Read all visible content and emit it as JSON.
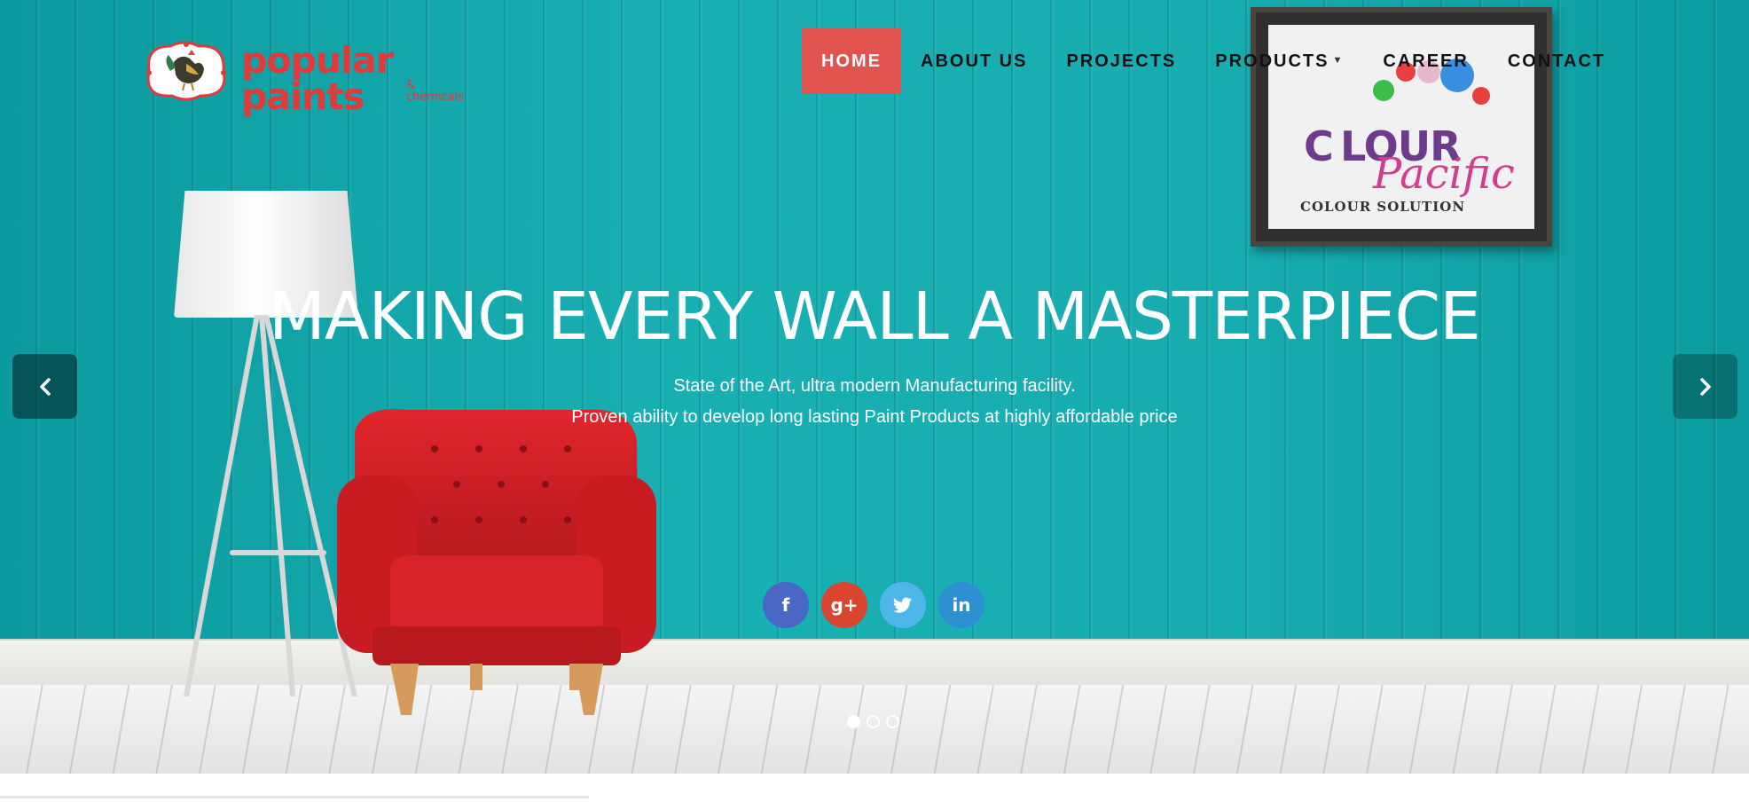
{
  "brand": {
    "name": "popular paints",
    "tagline": "& chemicals",
    "accent": "#e0534f"
  },
  "nav": {
    "items": [
      {
        "label": "HOME",
        "active": true
      },
      {
        "label": "ABOUT US",
        "active": false
      },
      {
        "label": "PROJECTS",
        "active": false
      },
      {
        "label": "PRODUCTS",
        "active": false,
        "dropdown": true
      },
      {
        "label": "CAREER",
        "active": false
      },
      {
        "label": "CONTACT",
        "active": false
      }
    ]
  },
  "hero": {
    "headline": "MAKING EVERY WALL A MASTERPIECE",
    "line1": "State of the Art, ultra modern Manufacturing facility.",
    "line2": "Proven ability to develop long lasting Paint Products at highly affordable price",
    "frame": {
      "brand_word1": "C LOUR",
      "brand_word2": "Pacific",
      "brand_line": "COLOUR SOLUTION"
    },
    "prev_icon": "chevron-left-icon",
    "next_icon": "chevron-right-icon"
  },
  "social": [
    {
      "name": "facebook",
      "glyph": "f",
      "color": "#4a67c6"
    },
    {
      "name": "google-plus",
      "glyph": "g+",
      "color": "#d9452f"
    },
    {
      "name": "twitter",
      "glyph": "t",
      "color": "#4fb6ec"
    },
    {
      "name": "linkedin",
      "glyph": "in",
      "color": "#2c8fcf"
    }
  ],
  "carousel": {
    "slides": 3,
    "active_index": 0
  }
}
